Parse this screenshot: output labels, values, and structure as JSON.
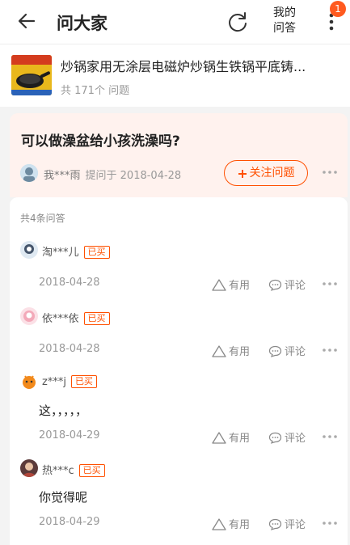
{
  "topbar": {
    "title": "问大家",
    "my_questions_line1": "我的",
    "my_questions_line2": "问答",
    "badge_count": "1"
  },
  "product": {
    "title": "炒锅家用无涂层电磁炉炒锅生铁锅平底铸...",
    "question_count": "共 171个 问题"
  },
  "question": {
    "text": "可以做澡盆给小孩洗澡吗?",
    "asker": "我***雨",
    "asked_on": "提问于 2018-04-28",
    "follow_label": "关注问题"
  },
  "answers_header": "共4条问答",
  "answer_actions": {
    "useful_label": "有用",
    "comment_label": "评论"
  },
  "answers": [
    {
      "user": "淘***儿",
      "badge": "已买",
      "text": "",
      "date": "2018-04-28"
    },
    {
      "user": "依***依",
      "badge": "已买",
      "text": "",
      "date": "2018-04-28"
    },
    {
      "user": "z***j",
      "badge": "已买",
      "text": "这，，，，，",
      "date": "2018-04-29"
    },
    {
      "user": "热***c",
      "badge": "已买",
      "text": "你觉得呢",
      "date": "2018-04-29"
    }
  ],
  "colors": {
    "accent": "#ff5000",
    "badge_bg": "#ff5a1f",
    "question_bg": "#fff2ee"
  }
}
